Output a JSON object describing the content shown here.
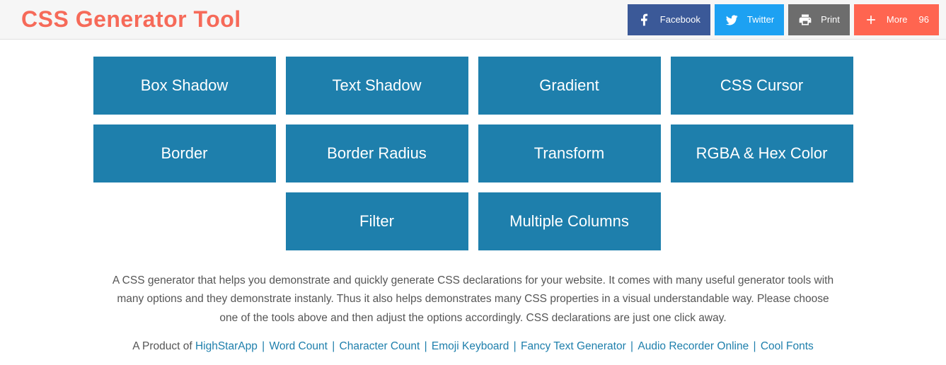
{
  "header": {
    "title": "CSS Generator Tool"
  },
  "share": {
    "facebook": "Facebook",
    "twitter": "Twitter",
    "print": "Print",
    "more": "More",
    "more_count": "96"
  },
  "tiles": [
    "Box Shadow",
    "Text Shadow",
    "Gradient",
    "CSS Cursor",
    "Border",
    "Border Radius",
    "Transform",
    "RGBA & Hex Color",
    "Filter",
    "Multiple Columns"
  ],
  "lead": "A CSS generator that helps you demonstrate and quickly generate CSS declarations for your website. It comes with many useful generator tools with many options and they demonstrate instanly. Thus it also helps demonstrates many CSS properties in a visual understandable way. Please choose one of the tools above and then adjust the options accordingly. CSS declarations are just one click away.",
  "footer": {
    "prefix": "A Product of ",
    "links": [
      "HighStarApp",
      "Word Count",
      "Character Count",
      "Emoji Keyboard",
      "Fancy Text Generator",
      "Audio Recorder Online",
      "Cool Fonts"
    ]
  }
}
